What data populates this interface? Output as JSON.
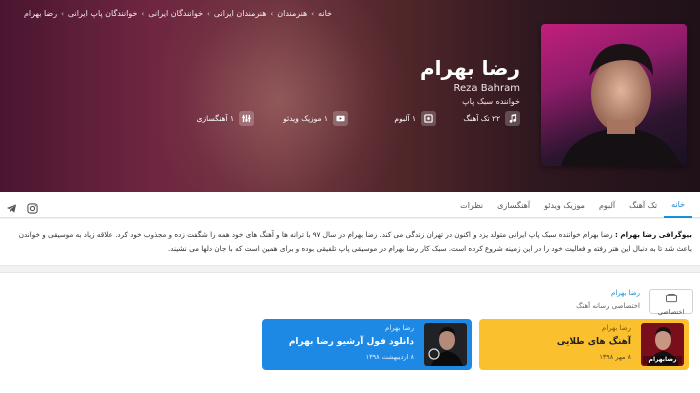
{
  "breadcrumb": [
    "خانه",
    "هنرمندان",
    "هنرمندان ایرانی",
    "خوانندگان ایرانی",
    "خوانندگان پاپ ایرانی",
    "رضا بهرام"
  ],
  "artist": {
    "name": "رضا بهرام",
    "latin": "Reza Bahram",
    "role": "خواننده سبک پاپ",
    "cover_label": "رضا بهرام"
  },
  "stats": [
    {
      "label": "۲۲ تک آهنگ",
      "icon": "music-note-icon"
    },
    {
      "label": "۱ آلبوم",
      "icon": "album-icon"
    },
    {
      "label": "۱ موزیک ویدئو",
      "icon": "video-icon"
    },
    {
      "label": "۱ آهنگسازی",
      "icon": "equalizer-icon"
    }
  ],
  "tabs": [
    "خانه",
    "تک آهنگ",
    "آلبوم",
    "موزیک ویدئو",
    "آهنگسازی",
    "نظرات"
  ],
  "social": [
    "instagram-icon",
    "telegram-icon"
  ],
  "bio": {
    "heading": "بیوگرافی رضا بهرام :",
    "text": "رضا بهرام خواننده سبک پاپ ایرانی متولد یزد و اکنون در تهران زندگی می کند. رضا بهرام در سال ۹۷ با ترانه ها و آهنگ های خود همه را شگفت زده و مجذوب خود کرد. علاقه زیاد به موسیقی و خواندن باعث شد تا به دنبال این هنر رفته و فعالیت خود را در این زمینه شروع کرده است. سبک کار رضا بهرام در موسیقی پاپ تلفیقی بوده و برای همین است که با جان دلها می نشیند."
  },
  "exclusive": {
    "box_label": "اختصاصی",
    "artist": "رضا بهرام",
    "subtitle": "اختصاصی رسانه آهنگ"
  },
  "cards": [
    {
      "artist": "رضا بهرام",
      "title": "آهنگ های طلایی",
      "date": "۸ مهر ۱۳۹۸",
      "thumb_label": "رضابهرام"
    },
    {
      "artist": "رضا بهرام",
      "title": "دانلود فول آرشیو رضا بهرام",
      "date": "۸ اردیبهشت ۱۳۹۸",
      "thumb_label": ""
    }
  ],
  "colors": {
    "accent": "#1b8fd6",
    "card_yellow": "#fbc02d",
    "card_blue": "#1e88e5"
  }
}
